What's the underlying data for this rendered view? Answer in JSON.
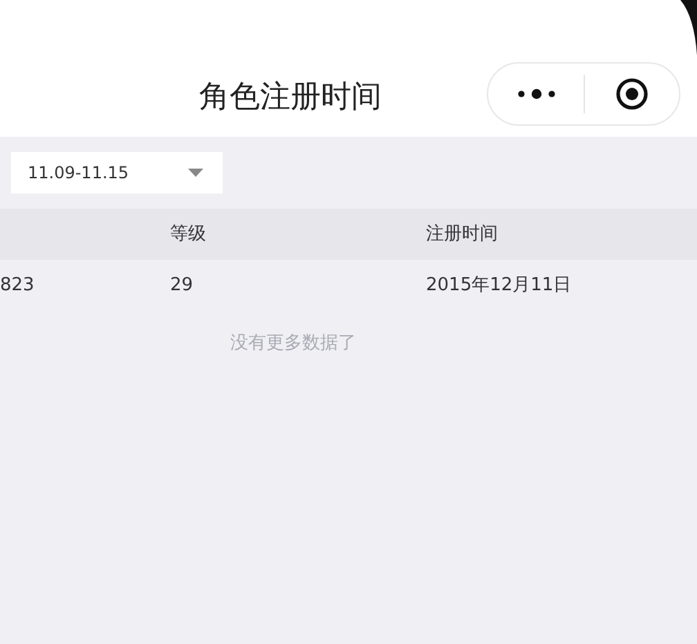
{
  "nav_bar": {
    "title": "角色注册时间"
  },
  "filter": {
    "value": "11.09-11.15"
  },
  "table": {
    "columns": [
      "",
      "等级",
      "注册时间"
    ],
    "rows": [
      [
        "823",
        "29",
        "2015年12月11日"
      ]
    ]
  },
  "footer_note": "没有更多数据了"
}
